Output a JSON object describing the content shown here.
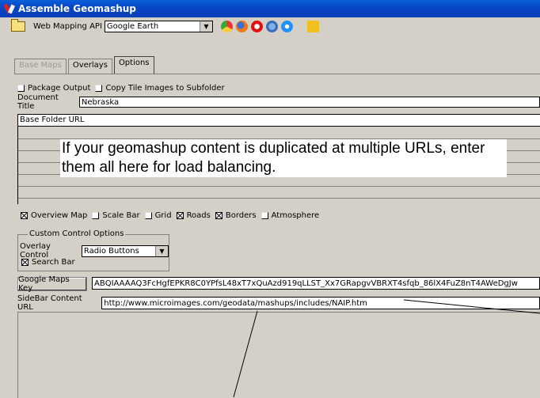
{
  "window": {
    "title": "Assemble Geomashup"
  },
  "toolbar": {
    "api_label": "Web Mapping API",
    "api_value": "Google Earth",
    "icons": [
      "folder-icon",
      "chrome-icon",
      "firefox-icon",
      "opera-icon",
      "netscape-icon",
      "ie-icon",
      "run-icon"
    ]
  },
  "tabs": [
    "Base Maps",
    "Overlays",
    "Options"
  ],
  "options": {
    "package_output": "Package Output",
    "copy_tiles": "Copy Tile Images to Subfolder",
    "doc_title_label": "Document Title",
    "doc_title_value": "Nebraska",
    "base_url_header": "Base Folder URL",
    "note": "If your geomashup content is duplicated at multiple URLs, enter them all here for load balancing.",
    "overview_map": "Overview Map",
    "scale_bar": "Scale Bar",
    "grid": "Grid",
    "roads": "Roads",
    "borders": "Borders",
    "atmosphere": "Atmosphere",
    "custom_group": "Custom Control Options",
    "overlay_control_label": "Overlay Control",
    "overlay_control_value": "Radio Buttons",
    "search_bar": "Search Bar",
    "gm_key_button": "Google Maps Key",
    "gm_key_value": "ABQIAAAAQ3FcHgfEPKR8C0YPfsL48xT7xQuAzd919qLLST_Xx7GRapgvVBRXT4sfqb_86lX4FuZ8nT4AWeDgJw",
    "sidebar_label": "SideBar Content URL",
    "sidebar_value": "http://www.microimages.com/geodata/mashups/includes/NAIP.htm"
  }
}
